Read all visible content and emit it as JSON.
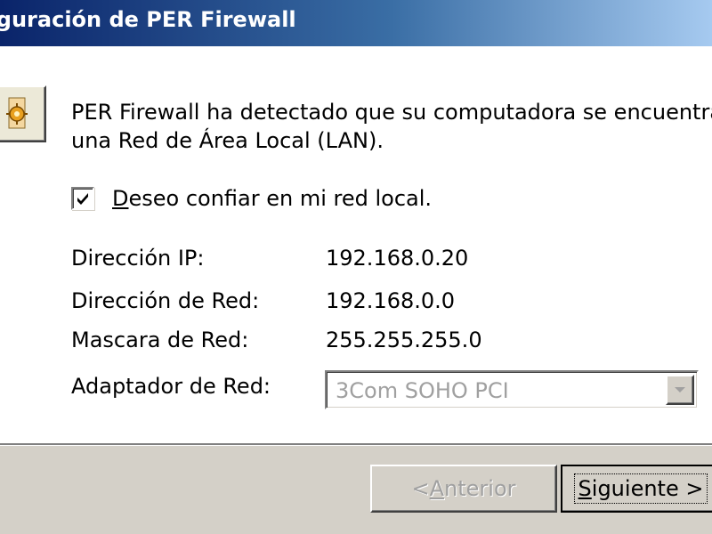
{
  "window": {
    "title": "figuración de PER Firewall",
    "title_gradient_start": "#0a246a",
    "title_gradient_end": "#a6caf0"
  },
  "icon": {
    "name": "firewall-wizard-icon"
  },
  "message": {
    "line1": "PER Firewall ha detectado que su computadora se encuentra en",
    "line2": "una Red de Área Local (LAN)."
  },
  "trust_checkbox": {
    "checked": true,
    "label_mnemonic": "D",
    "label_rest": "eseo confiar en mi red local."
  },
  "fields": {
    "ip_label": "Dirección IP:",
    "ip_value": "192.168.0.20",
    "network_label": "Dirección de Red:",
    "network_value": "192.168.0.0",
    "mask_label": "Mascara de Red:",
    "mask_value": "255.255.255.0",
    "adapter_label": "Adaptador de Red:",
    "adapter_value": "3Com SOHO PCI"
  },
  "buttons": {
    "prev_prefix": "< ",
    "prev_mnemonic": "A",
    "prev_rest": "nterior",
    "next_mnemonic": "S",
    "next_rest": "iguiente >"
  }
}
